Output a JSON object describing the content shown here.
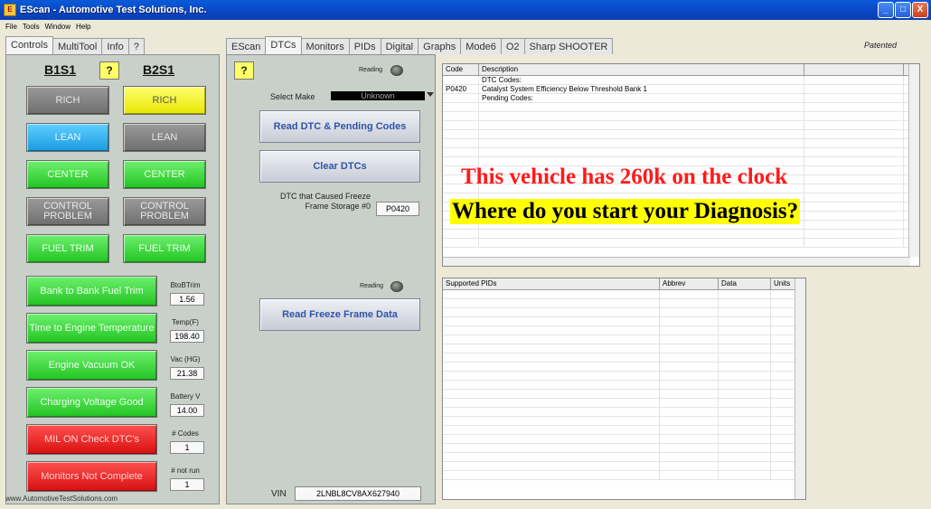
{
  "window": {
    "title": "EScan - Automotive Test Solutions, Inc.",
    "buttons": [
      "_",
      "□",
      "X"
    ]
  },
  "menu": [
    "File",
    "Tools",
    "Window",
    "Help"
  ],
  "left_tabs": [
    "Controls",
    "MultiTool",
    "Info",
    "?"
  ],
  "right_tabs": [
    "EScan",
    "DTCs",
    "Monitors",
    "PIDs",
    "Digital",
    "Graphs",
    "Mode6",
    "O2",
    "Sharp SHOOTER"
  ],
  "patented": "Patented",
  "sensors": {
    "b1": "B1S1",
    "b2": "B2S1",
    "help": "?"
  },
  "indicators": {
    "b1_rich": "RICH",
    "b1_lean": "LEAN",
    "b1_center": "CENTER",
    "b1_control": "CONTROL PROBLEM",
    "b1_fuel": "FUEL TRIM",
    "b2_rich": "RICH",
    "b2_lean": "LEAN",
    "b2_center": "CENTER",
    "b2_control": "CONTROL PROBLEM",
    "b2_fuel": "FUEL TRIM"
  },
  "status": [
    {
      "label": "Bank to Bank Fuel Trim",
      "name": "BtoBTrim",
      "value": "1.56"
    },
    {
      "label": "Time to Engine Temperature",
      "name": "Temp(F)",
      "value": "198.40"
    },
    {
      "label": "Engine Vacuum OK",
      "name": "Vac (HG)",
      "value": "21.38"
    },
    {
      "label": "Charging Voltage Good",
      "name": "Battery V",
      "value": "14.00"
    },
    {
      "label": "MIL ON Check DTC's",
      "name": "# Codes",
      "value": "1"
    },
    {
      "label": "Monitors Not Complete",
      "name": "# not run",
      "value": "1"
    }
  ],
  "url": "www.AutomotiveTestSolutions.com",
  "dtc": {
    "help": "?",
    "reading1": "Reading",
    "select_make_label": "Select Make",
    "select_make_value": "Unknown",
    "read_btn": "Read DTC & Pending Codes",
    "clear_btn": "Clear DTCs",
    "freeze_label": "DTC that Caused Freeze Frame Storage #0",
    "freeze_value": "P0420",
    "reading2": "Reading",
    "read_freeze_btn": "Read Freeze Frame Data",
    "vin_label": "VIN",
    "vin_value": "2LNBL8CV8AX627940"
  },
  "codes_table": {
    "headers": [
      "Code",
      "Description"
    ],
    "rows": [
      [
        "",
        "DTC Codes:"
      ],
      [
        "P0420",
        "Catalyst System Efficiency Below Threshold Bank 1"
      ],
      [
        "",
        "Pending Codes:"
      ]
    ]
  },
  "pids_table": {
    "headers": [
      "Supported PIDs",
      "Abbrev",
      "Data",
      "Units"
    ]
  },
  "overlay": {
    "line1": "This vehicle has 260k on the clock",
    "line2": "Where do you start your Diagnosis?"
  },
  "colors": {
    "red_text": "#ff1a1a",
    "highlight": "#ffff00",
    "button_text": "#2f55a8"
  }
}
